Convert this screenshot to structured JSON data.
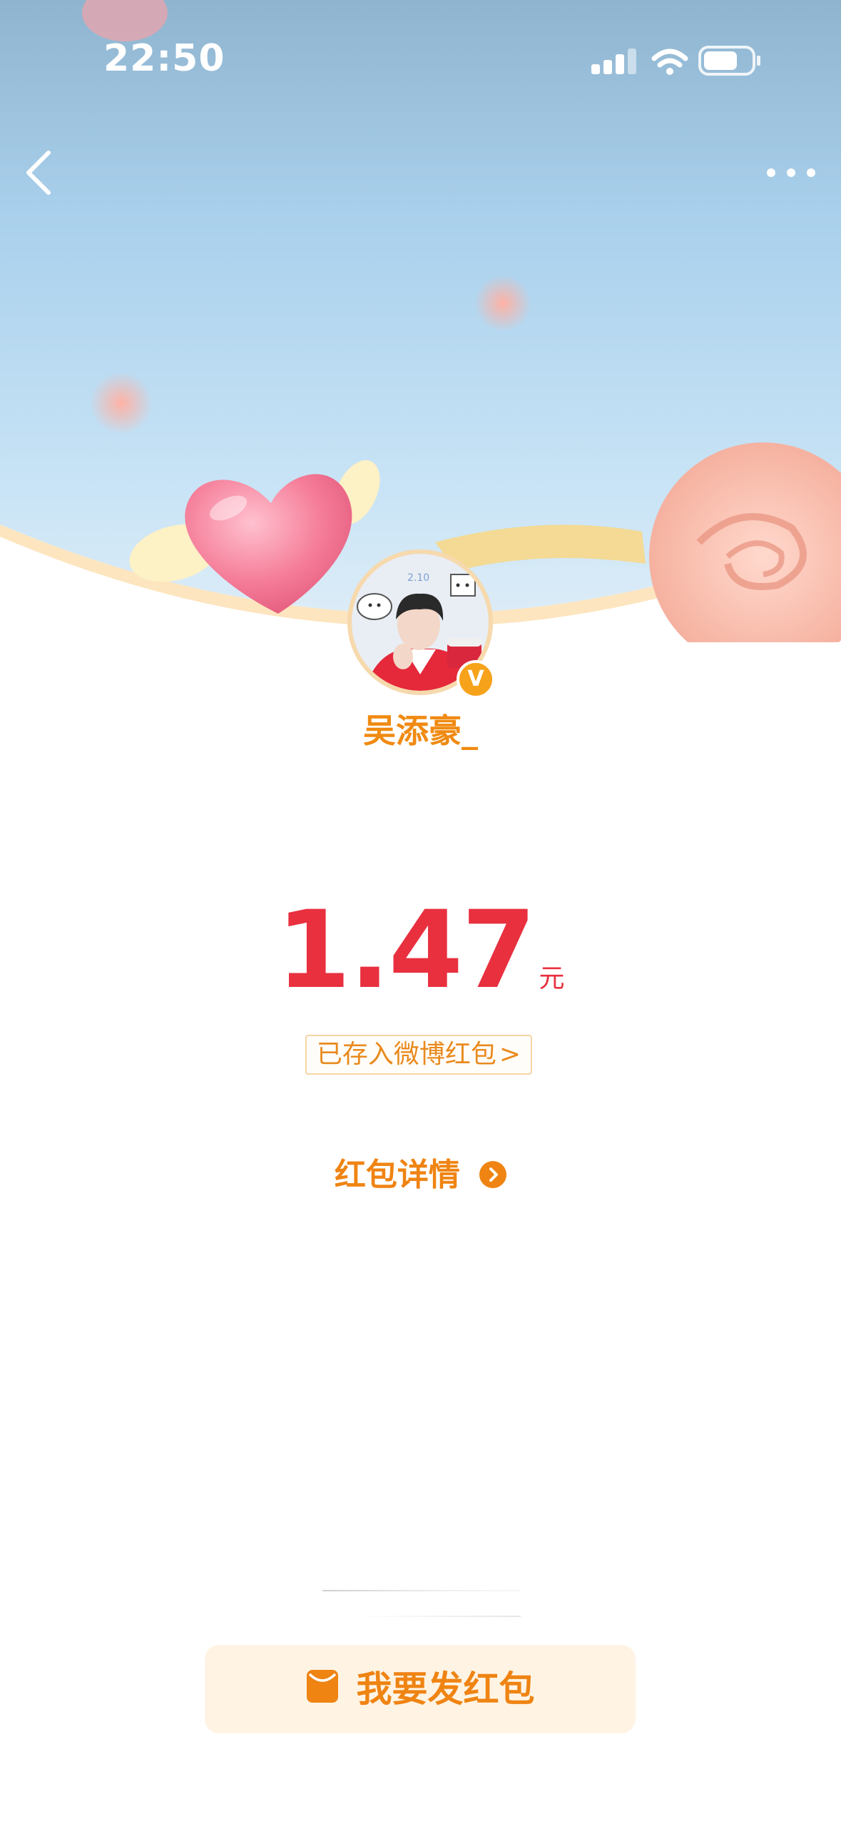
{
  "status_bar": {
    "time": "22:50",
    "icons": [
      "signal-icon",
      "wifi-icon",
      "battery-icon"
    ]
  },
  "nav": {
    "back_icon": "back-chevron-icon",
    "more_icon": "more-dots-icon"
  },
  "sender": {
    "name": "吴添豪_",
    "badge": "V"
  },
  "red_packet": {
    "amount": "1.47",
    "unit": "元",
    "saved_label": "已存入微博红包",
    "saved_chevron": ">",
    "details_label": "红包详情"
  },
  "footer": {
    "send_label": "我要发红包",
    "send_icon": "red-packet-icon"
  },
  "colors": {
    "amount": "#e8303f",
    "accent_orange": "#ef8413",
    "username": "#f08a12",
    "button_bg": "#fff4e4"
  }
}
